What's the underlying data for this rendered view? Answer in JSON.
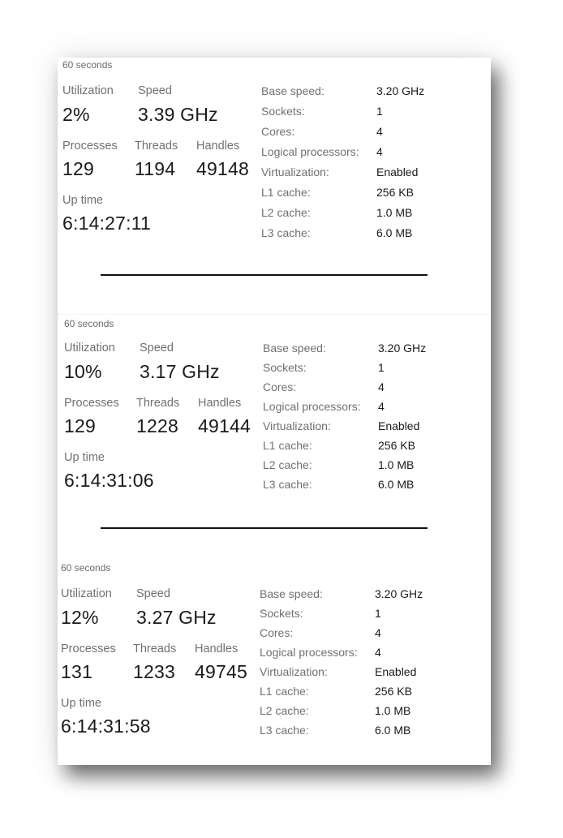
{
  "sections": [
    {
      "timespan": "60 seconds",
      "utilization": {
        "label": "Utilization",
        "value": "2%"
      },
      "speed": {
        "label": "Speed",
        "value": "3.39 GHz"
      },
      "processes": {
        "label": "Processes",
        "value": "129"
      },
      "threads": {
        "label": "Threads",
        "value": "1194"
      },
      "handles": {
        "label": "Handles",
        "value": "49148"
      },
      "uptime": {
        "label": "Up time",
        "value": "6:14:27:11"
      },
      "specs": [
        {
          "label": "Base speed:",
          "value": "3.20 GHz"
        },
        {
          "label": "Sockets:",
          "value": "1"
        },
        {
          "label": "Cores:",
          "value": "4"
        },
        {
          "label": "Logical processors:",
          "value": "4"
        },
        {
          "label": "Virtualization:",
          "value": "Enabled"
        },
        {
          "label": "L1 cache:",
          "value": "256 KB"
        },
        {
          "label": "L2 cache:",
          "value": "1.0 MB"
        },
        {
          "label": "L3 cache:",
          "value": "6.0 MB"
        }
      ]
    },
    {
      "timespan": "60 seconds",
      "utilization": {
        "label": "Utilization",
        "value": "10%"
      },
      "speed": {
        "label": "Speed",
        "value": "3.17 GHz"
      },
      "processes": {
        "label": "Processes",
        "value": "129"
      },
      "threads": {
        "label": "Threads",
        "value": "1228"
      },
      "handles": {
        "label": "Handles",
        "value": "49144"
      },
      "uptime": {
        "label": "Up time",
        "value": "6:14:31:06"
      },
      "specs": [
        {
          "label": "Base speed:",
          "value": "3.20 GHz"
        },
        {
          "label": "Sockets:",
          "value": "1"
        },
        {
          "label": "Cores:",
          "value": "4"
        },
        {
          "label": "Logical processors:",
          "value": "4"
        },
        {
          "label": "Virtualization:",
          "value": "Enabled"
        },
        {
          "label": "L1 cache:",
          "value": "256 KB"
        },
        {
          "label": "L2 cache:",
          "value": "1.0 MB"
        },
        {
          "label": "L3 cache:",
          "value": "6.0 MB"
        }
      ]
    },
    {
      "timespan": "60 seconds",
      "utilization": {
        "label": "Utilization",
        "value": "12%"
      },
      "speed": {
        "label": "Speed",
        "value": "3.27 GHz"
      },
      "processes": {
        "label": "Processes",
        "value": "131"
      },
      "threads": {
        "label": "Threads",
        "value": "1233"
      },
      "handles": {
        "label": "Handles",
        "value": "49745"
      },
      "uptime": {
        "label": "Up time",
        "value": "6:14:31:58"
      },
      "specs": [
        {
          "label": "Base speed:",
          "value": "3.20 GHz"
        },
        {
          "label": "Sockets:",
          "value": "1"
        },
        {
          "label": "Cores:",
          "value": "4"
        },
        {
          "label": "Logical processors:",
          "value": "4"
        },
        {
          "label": "Virtualization:",
          "value": "Enabled"
        },
        {
          "label": "L1 cache:",
          "value": "256 KB"
        },
        {
          "label": "L2 cache:",
          "value": "1.0 MB"
        },
        {
          "label": "L3 cache:",
          "value": "6.0 MB"
        }
      ]
    }
  ]
}
